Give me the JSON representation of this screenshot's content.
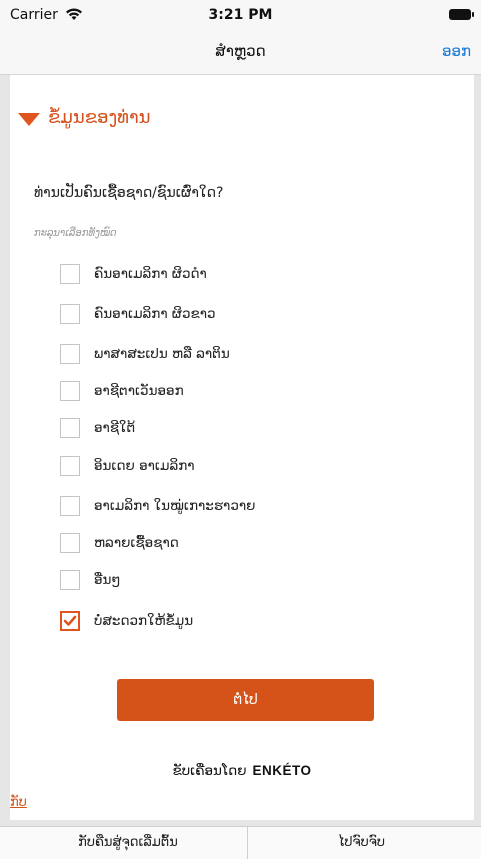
{
  "status_bar": {
    "carrier": "Carrier",
    "time": "3:21 PM"
  },
  "nav": {
    "title": "ສຳຫຼວດ",
    "action": "ອອກ"
  },
  "section": {
    "title": "ຂໍ້ມູນຂອງທ່ານ"
  },
  "question": {
    "text": "ທ່ານເປັນຄົນເຊື້ອຊາດ/ຊົນເຜົ່າໃດ?",
    "hint": "ກະລຸນາເລືອກທັງໝົດ"
  },
  "options": [
    {
      "label": "ຄົນອາເມລິກາ ຜິວດຳ",
      "checked": false
    },
    {
      "label": "ຄົນອາເມລິກາ ຜິວຂາວ",
      "checked": false
    },
    {
      "label": "ພາສາສະເປນ ຫລື ລາຕິນ",
      "checked": false
    },
    {
      "label": "ອາຊີຕາເວັນອອກ",
      "checked": false
    },
    {
      "label": "ອາຊີໃຕ້",
      "checked": false
    },
    {
      "label": "ອິນເດຍ ອາເມລິກາ",
      "checked": false
    },
    {
      "label": "ອາເມລິກາ ໃນໝູ່ເກາະຮາວາຍ",
      "checked": false
    },
    {
      "label": "ຫລາຍເຊື້ອຊາດ",
      "checked": false
    },
    {
      "label": "ອື່ນໆ",
      "checked": false
    },
    {
      "label": "ບໍ່ສະດວກໃຫ້ຂໍ້ມູນ",
      "checked": true
    }
  ],
  "next_button": "ຕໍ່ໄປ",
  "powered_by": {
    "prefix": "ຂັບເຄື່ອນໂດຍ",
    "brand": "ENKÉTO"
  },
  "back_link": "ກັບ",
  "bottom_tabs": {
    "left": "ກັບຄືນສູ່ຈຸດເລີ່ມຕົ້ນ",
    "right": "ໄປຈົບຈົບ"
  },
  "colors": {
    "accent": "#d55318",
    "link": "#1a7bd8"
  }
}
